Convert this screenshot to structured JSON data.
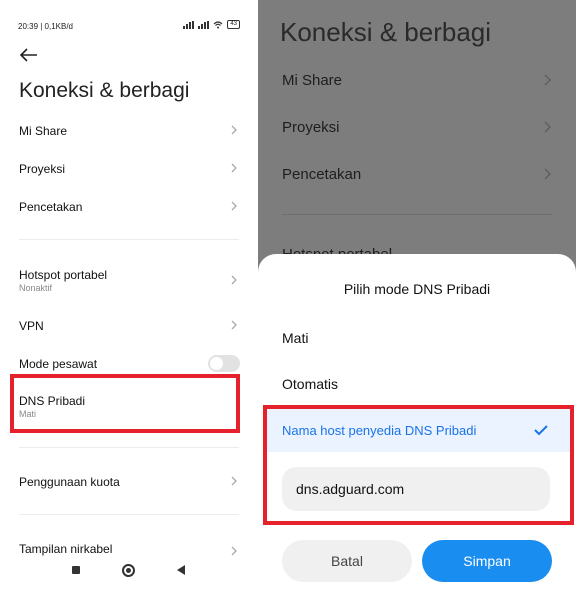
{
  "status_bar": {
    "time": "20:39 | 0,1KB/d",
    "battery": "43"
  },
  "left": {
    "title": "Koneksi & berbagi",
    "items": [
      {
        "label": "Mi Share"
      },
      {
        "label": "Proyeksi"
      },
      {
        "label": "Pencetakan"
      },
      {
        "label": "Hotspot portabel",
        "sub": "Nonaktif"
      },
      {
        "label": "VPN"
      },
      {
        "label": "Mode pesawat",
        "toggle": false
      },
      {
        "label": "DNS Pribadi",
        "sub": "Mati"
      },
      {
        "label": "Penggunaan kuota"
      },
      {
        "label": "Tampilan nirkabel"
      }
    ]
  },
  "right": {
    "title": "Koneksi & berbagi",
    "items": [
      {
        "label": "Mi Share"
      },
      {
        "label": "Proyeksi"
      },
      {
        "label": "Pencetakan"
      }
    ],
    "peek_label": "Hotspot portabel",
    "dialog": {
      "title": "Pilih mode DNS Pribadi",
      "options": [
        "Mati",
        "Otomatis",
        "Nama host penyedia DNS Pribadi"
      ],
      "selected_index": 2,
      "hostname_value": "dns.adguard.com",
      "cancel_label": "Batal",
      "save_label": "Simpan"
    }
  },
  "colors": {
    "accent": "#1a73e8",
    "save_button": "#1a8df0",
    "highlight": "#e5222c",
    "scrim": "#7d7d7d"
  }
}
